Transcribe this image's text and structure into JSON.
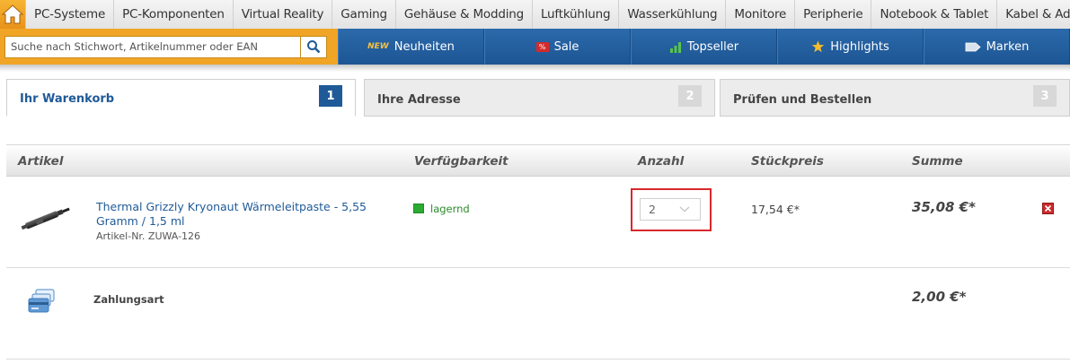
{
  "top_nav": {
    "home_icon": "home-icon",
    "categories": [
      "PC-Systeme",
      "PC-Komponenten",
      "Virtual Reality",
      "Gaming",
      "Gehäuse & Modding",
      "Luftkühlung",
      "Wasserkühlung",
      "Monitore",
      "Peripherie",
      "Notebook & Tablet",
      "Kabel & Adapter"
    ]
  },
  "search": {
    "placeholder": "Suche nach Stichwort, Artikelnummer oder EAN",
    "icon": "search-icon"
  },
  "quick_nav": [
    {
      "badge": "NEW",
      "label": "Neuheiten"
    },
    {
      "badge": "%",
      "label": "Sale"
    },
    {
      "icon": "bar-chart-icon",
      "label": "Topseller"
    },
    {
      "icon": "star-icon",
      "label": "Highlights"
    },
    {
      "icon": "tag-icon",
      "label": "Marken"
    }
  ],
  "steps": [
    {
      "label": "Ihr Warenkorb",
      "num": "1",
      "active": true
    },
    {
      "label": "Ihre Adresse",
      "num": "2",
      "active": false
    },
    {
      "label": "Prüfen und Bestellen",
      "num": "3",
      "active": false
    }
  ],
  "table": {
    "headers": [
      "Artikel",
      "Verfügbarkeit",
      "Anzahl",
      "Stückpreis",
      "Summe"
    ],
    "items": [
      {
        "title": "Thermal Grizzly Kryonaut Wärmeleitpaste - 5,55 Gramm / 1,5 ml",
        "sku": "Artikel-Nr. ZUWA-126",
        "availability": "lagernd",
        "quantity": "2",
        "unit_price": "17,54 €*",
        "total": "35,08 €*"
      }
    ],
    "payment": {
      "label": "Zahlungsart",
      "total": "2,00 €*"
    }
  },
  "colors": {
    "brand_blue": "#1f5a98",
    "accent_orange": "#f0a526",
    "highlight_red": "#d8282b",
    "stock_green": "#2bab32"
  }
}
